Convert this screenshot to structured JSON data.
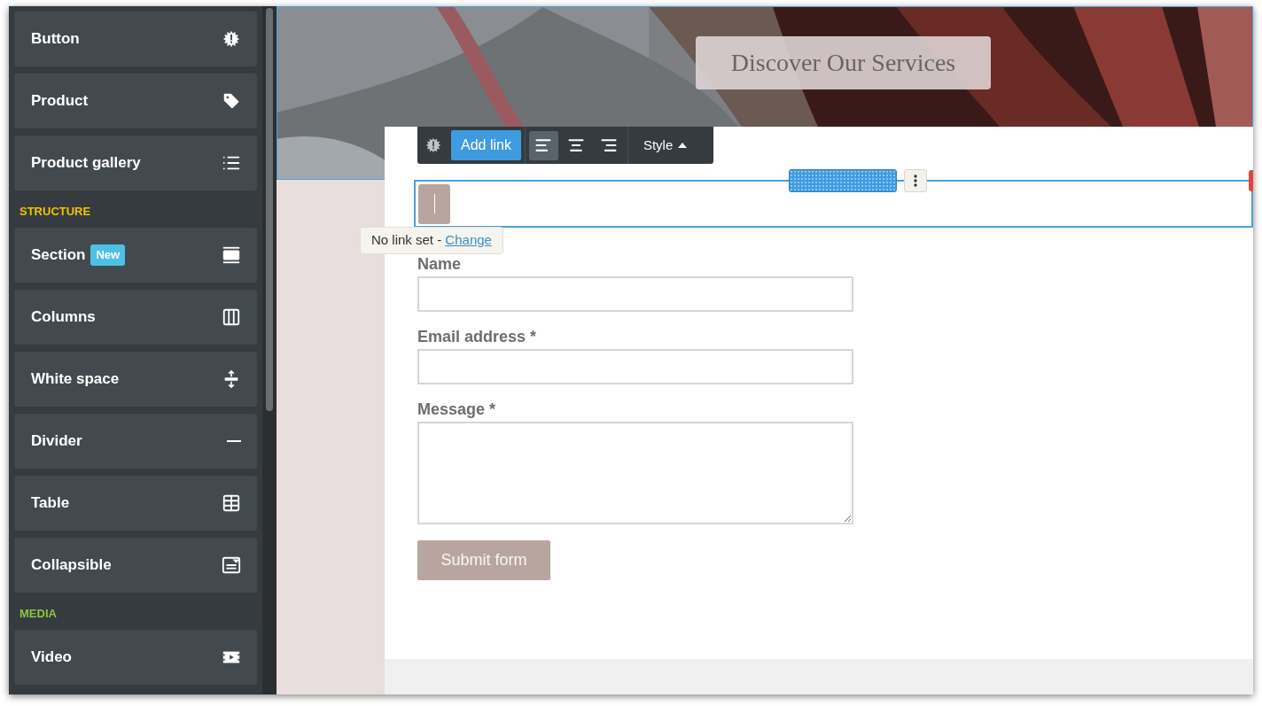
{
  "sidebar": {
    "groups": [
      {
        "items": [
          {
            "label": "Button",
            "kind": "badge"
          },
          {
            "label": "Product",
            "kind": "tag"
          },
          {
            "label": "Product gallery",
            "kind": "list"
          }
        ]
      },
      {
        "heading": "STRUCTURE",
        "color": "#f2c200",
        "items": [
          {
            "label": "Section",
            "kind": "section",
            "badge": "New"
          },
          {
            "label": "Columns",
            "kind": "columns"
          },
          {
            "label": "White space",
            "kind": "space"
          },
          {
            "label": "Divider",
            "kind": "divider"
          },
          {
            "label": "Table",
            "kind": "table"
          },
          {
            "label": "Collapsible",
            "kind": "collapsible"
          }
        ]
      },
      {
        "heading": "MEDIA",
        "color": "#8cc63f",
        "items": [
          {
            "label": "Video",
            "kind": "video"
          }
        ]
      }
    ]
  },
  "hero": {
    "button_label": "Discover Our Services"
  },
  "toolbar": {
    "add_link": "Add link",
    "alignments": [
      {
        "kind": "left",
        "selected": true
      },
      {
        "kind": "center",
        "selected": false
      },
      {
        "kind": "right",
        "selected": false
      }
    ],
    "style": "Style"
  },
  "tooltip": {
    "text": "No link set - ",
    "link": "Change"
  },
  "form": {
    "fields": [
      {
        "label": "Name",
        "kind": "input"
      },
      {
        "label": "Email address *",
        "kind": "input"
      },
      {
        "label": "Message *",
        "kind": "textarea"
      }
    ],
    "submit": "Submit form"
  }
}
